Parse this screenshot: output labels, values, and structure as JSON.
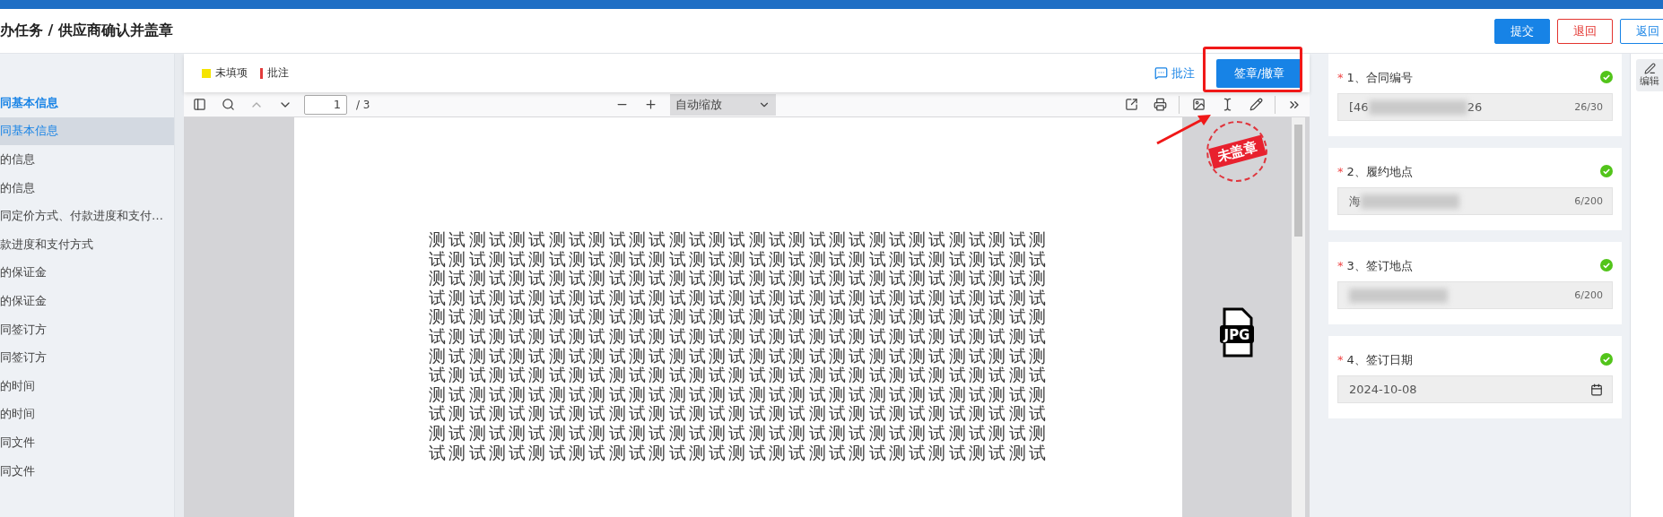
{
  "header": {
    "title": "办任务 / 供应商确认并盖章",
    "buttons": [
      {
        "label": "提交",
        "kind": "primary"
      },
      {
        "label": "退回",
        "kind": "danger"
      },
      {
        "label": "返回",
        "kind": "outline"
      }
    ]
  },
  "sidebar": {
    "items": [
      {
        "label": "同基本信息",
        "kind": "heading",
        "selected": false
      },
      {
        "label": "同基本信息",
        "kind": "item",
        "selected": true
      },
      {
        "label": "的信息",
        "kind": "item",
        "selected": false
      },
      {
        "label": "的信息",
        "kind": "item",
        "selected": false
      },
      {
        "label": "同定价方式、付款进度和支付…",
        "kind": "item",
        "selected": false
      },
      {
        "label": "款进度和支付方式",
        "kind": "item",
        "selected": false
      },
      {
        "label": "的保证金",
        "kind": "item",
        "selected": false
      },
      {
        "label": "的保证金",
        "kind": "item",
        "selected": false
      },
      {
        "label": "同签订方",
        "kind": "item",
        "selected": false
      },
      {
        "label": "同签订方",
        "kind": "item",
        "selected": false
      },
      {
        "label": "的时间",
        "kind": "item",
        "selected": false
      },
      {
        "label": "的时间",
        "kind": "item",
        "selected": false
      },
      {
        "label": "同文件",
        "kind": "item",
        "selected": false
      },
      {
        "label": "同文件",
        "kind": "item",
        "selected": false
      }
    ]
  },
  "legend": [
    {
      "label": "未填项",
      "kind": "square",
      "color": "#f5e400"
    },
    {
      "label": "批注",
      "kind": "bar",
      "color": "#e23b3b"
    }
  ],
  "annotate_link": "批注",
  "sign_button": "签章/撤章",
  "pdf_toolbar": {
    "page": "1",
    "page_count": "/ 3",
    "zoom": "自动缩放"
  },
  "document": {
    "stamp": "未盖章",
    "file_label": "JPG",
    "lines": [
      "测试测试测试测试测试测试测试测试测试测试测试测试测试测试测试测",
      "试测试测试测试测试测试测试测试测试测试测试测试测试测试测试测试",
      "测试测试测试测试测试测试测试测试测试测试测试测试测试测试测试测",
      "试测试测试测试测试测试测试测试测试测试测试测试测试测试测试测试",
      "测试测试测试测试测试测试测试测试测试测试测试测试测试测试测试测",
      "试测试测试测试测试测试测试测试测试测试测试测试测试测试测试测试",
      "测试测试测试测试测试测试测试测试测试测试测试测试测试测试测试测",
      "试测试测试测试测试测试测试测试测试测试测试测试测试测试测试测试",
      "测试测试测试测试测试测试测试测试测试测试测试测试测试测试测试测",
      "试测试测试测试测试测试测试测试测试测试测试测试测试测试测试测试",
      "测试测试测试测试测试测试测试测试测试测试测试测试测试测试测试测",
      "试测试测试测试测试测试测试测试测试测试测试测试测试测试测试测试"
    ]
  },
  "fields": [
    {
      "label": "1、合同编号",
      "kind": "text",
      "required_mark": "*",
      "valid": true,
      "value_start": "[46",
      "value_end": "26",
      "blurred": true,
      "count": "26/30"
    },
    {
      "label": "2、履约地点",
      "kind": "text",
      "required_mark": "*",
      "valid": true,
      "value_start": "海",
      "blurred": true,
      "count": "6/200"
    },
    {
      "label": "3、签订地点",
      "kind": "text",
      "required_mark": "*",
      "valid": true,
      "blurred": true,
      "count": "6/200"
    },
    {
      "label": "4、签订日期",
      "kind": "date",
      "required_mark": "*",
      "valid": true,
      "value_start": "2024-10-08"
    }
  ],
  "edit_button": "编辑"
}
